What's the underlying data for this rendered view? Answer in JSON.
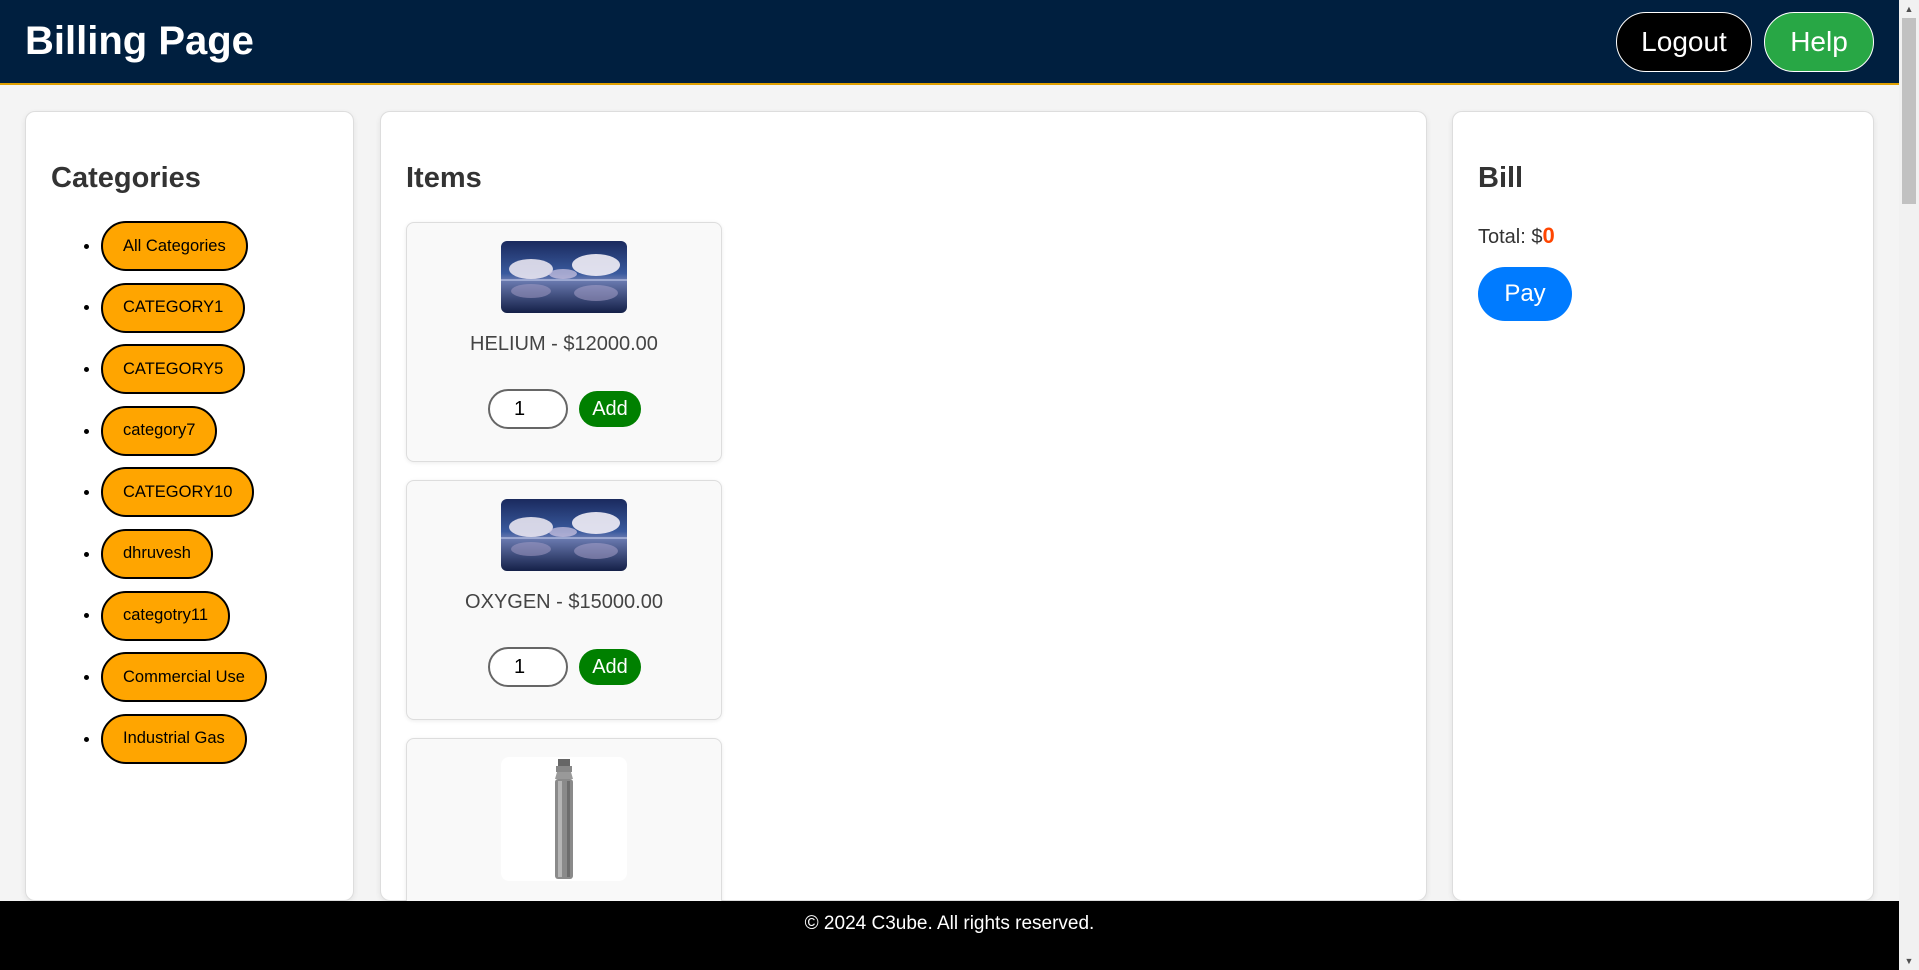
{
  "header": {
    "title": "Billing Page",
    "logout_label": "Logout",
    "help_label": "Help"
  },
  "categories": {
    "heading": "Categories",
    "items": [
      {
        "label": "All Categories"
      },
      {
        "label": "CATEGORY1"
      },
      {
        "label": "CATEGORY5"
      },
      {
        "label": "category7"
      },
      {
        "label": "CATEGORY10"
      },
      {
        "label": "dhruvesh"
      },
      {
        "label": "categotry11"
      },
      {
        "label": "Commercial Use"
      },
      {
        "label": "Industrial Gas"
      }
    ]
  },
  "items": {
    "heading": "Items",
    "list": [
      {
        "name": "HELIUM - $12000.00",
        "qty": "1",
        "add_label": "Add",
        "image": "sky-clouds-image"
      },
      {
        "name": "OXYGEN - $15000.00",
        "qty": "1",
        "add_label": "Add",
        "image": "sky-clouds-image"
      },
      {
        "image": "gas-cylinder-image"
      }
    ]
  },
  "bill": {
    "heading": "Bill",
    "total_label": "Total: $",
    "total_value": "0",
    "pay_label": "Pay"
  },
  "footer": {
    "text": "© 2024 C3ube. All rights reserved."
  },
  "colors": {
    "header_bg": "#001f3f",
    "category_button": "#ffa500",
    "add_button": "#008000",
    "pay_button": "#007bff",
    "help_button": "#28a745",
    "total_value": "#ff4500"
  }
}
